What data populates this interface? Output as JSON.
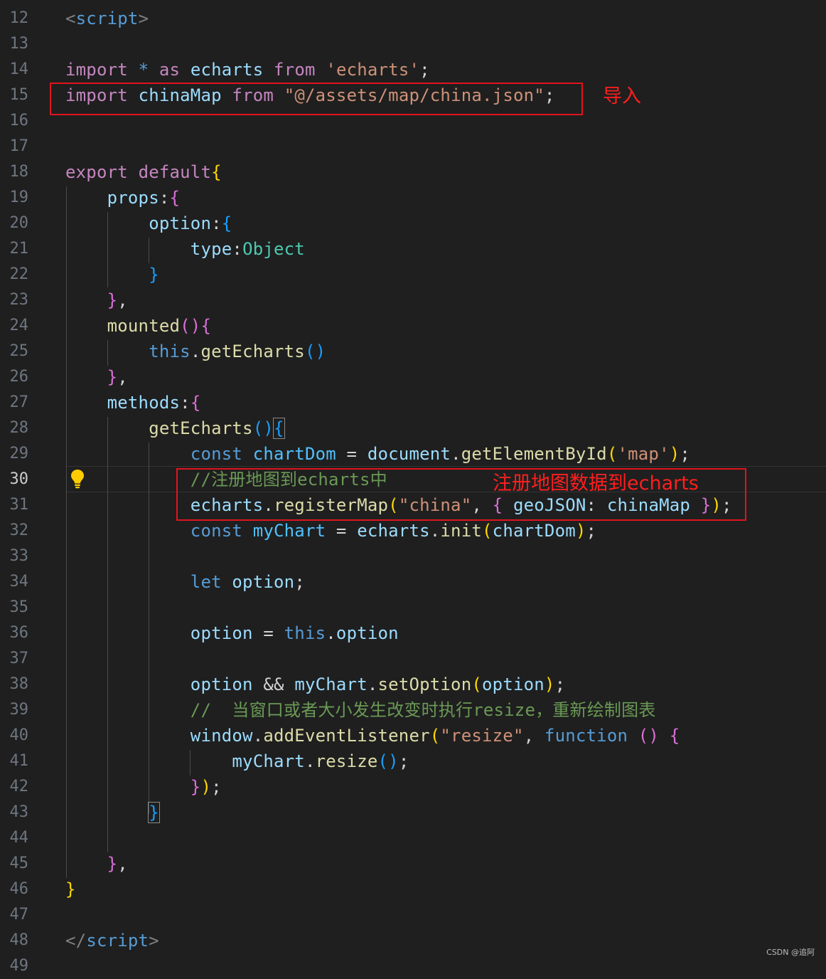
{
  "editor": {
    "active_line": "30",
    "lines": [
      {
        "n": "12",
        "t": [
          [
            "<",
            "#808080"
          ],
          [
            "script",
            "#569cd6"
          ],
          [
            ">",
            "#808080"
          ]
        ]
      },
      {
        "n": "13",
        "t": []
      },
      {
        "n": "14",
        "t": [
          [
            "import",
            "#c586c0"
          ],
          [
            " ",
            "#d4d4d4"
          ],
          [
            "*",
            "#569cd6"
          ],
          [
            " ",
            "#d4d4d4"
          ],
          [
            "as",
            "#c586c0"
          ],
          [
            " ",
            "#d4d4d4"
          ],
          [
            "echarts",
            "#9cdcfe"
          ],
          [
            " ",
            "#d4d4d4"
          ],
          [
            "from",
            "#c586c0"
          ],
          [
            " ",
            "#d4d4d4"
          ],
          [
            "'echarts'",
            "#ce9178"
          ],
          [
            ";",
            "#d4d4d4"
          ]
        ]
      },
      {
        "n": "15",
        "t": [
          [
            "import",
            "#c586c0"
          ],
          [
            " ",
            "#d4d4d4"
          ],
          [
            "chinaMap",
            "#9cdcfe"
          ],
          [
            " ",
            "#d4d4d4"
          ],
          [
            "from",
            "#c586c0"
          ],
          [
            " ",
            "#d4d4d4"
          ],
          [
            "\"@/assets/map/china.json\"",
            "#ce9178"
          ],
          [
            ";",
            "#d4d4d4"
          ]
        ]
      },
      {
        "n": "16",
        "t": []
      },
      {
        "n": "17",
        "t": []
      },
      {
        "n": "18",
        "t": [
          [
            "export",
            "#c586c0"
          ],
          [
            " ",
            "#d4d4d4"
          ],
          [
            "default",
            "#c586c0"
          ],
          [
            "{",
            "#ffd700"
          ]
        ]
      },
      {
        "n": "19",
        "t": [
          [
            "    ",
            "#d4d4d4"
          ],
          [
            "props",
            "#9cdcfe"
          ],
          [
            ":",
            "#d4d4d4"
          ],
          [
            "{",
            "#da70d6"
          ]
        ]
      },
      {
        "n": "20",
        "t": [
          [
            "        ",
            "#d4d4d4"
          ],
          [
            "option",
            "#9cdcfe"
          ],
          [
            ":",
            "#d4d4d4"
          ],
          [
            "{",
            "#179fff"
          ]
        ]
      },
      {
        "n": "21",
        "t": [
          [
            "            ",
            "#d4d4d4"
          ],
          [
            "type",
            "#9cdcfe"
          ],
          [
            ":",
            "#d4d4d4"
          ],
          [
            "Object",
            "#4ec9b0"
          ]
        ]
      },
      {
        "n": "22",
        "t": [
          [
            "        ",
            "#d4d4d4"
          ],
          [
            "}",
            "#179fff"
          ]
        ]
      },
      {
        "n": "23",
        "t": [
          [
            "    ",
            "#d4d4d4"
          ],
          [
            "}",
            "#da70d6"
          ],
          [
            ",",
            "#d4d4d4"
          ]
        ]
      },
      {
        "n": "24",
        "t": [
          [
            "    ",
            "#d4d4d4"
          ],
          [
            "mounted",
            "#dcdcaa"
          ],
          [
            "()",
            "#da70d6"
          ],
          [
            "{",
            "#da70d6"
          ]
        ]
      },
      {
        "n": "25",
        "t": [
          [
            "        ",
            "#d4d4d4"
          ],
          [
            "this",
            "#569cd6"
          ],
          [
            ".",
            "#d4d4d4"
          ],
          [
            "getEcharts",
            "#dcdcaa"
          ],
          [
            "()",
            "#179fff"
          ]
        ]
      },
      {
        "n": "26",
        "t": [
          [
            "    ",
            "#d4d4d4"
          ],
          [
            "}",
            "#da70d6"
          ],
          [
            ",",
            "#d4d4d4"
          ]
        ]
      },
      {
        "n": "27",
        "t": [
          [
            "    ",
            "#d4d4d4"
          ],
          [
            "methods",
            "#9cdcfe"
          ],
          [
            ":",
            "#d4d4d4"
          ],
          [
            "{",
            "#da70d6"
          ]
        ]
      },
      {
        "n": "28",
        "t": [
          [
            "        ",
            "#d4d4d4"
          ],
          [
            "getEcharts",
            "#dcdcaa"
          ],
          [
            "()",
            "#179fff"
          ],
          [
            "{",
            "#179fff",
            "m"
          ]
        ]
      },
      {
        "n": "29",
        "t": [
          [
            "            ",
            "#d4d4d4"
          ],
          [
            "const",
            "#569cd6"
          ],
          [
            " ",
            "#d4d4d4"
          ],
          [
            "chartDom",
            "#4fc1ff"
          ],
          [
            " = ",
            "#d4d4d4"
          ],
          [
            "document",
            "#9cdcfe"
          ],
          [
            ".",
            "#d4d4d4"
          ],
          [
            "getElementById",
            "#dcdcaa"
          ],
          [
            "(",
            "#ffd700"
          ],
          [
            "'map'",
            "#ce9178"
          ],
          [
            ")",
            "#ffd700"
          ],
          [
            ";",
            "#d4d4d4"
          ]
        ]
      },
      {
        "n": "30",
        "t": [
          [
            "            ",
            "#d4d4d4"
          ],
          [
            "//注册地图到echarts中",
            "#6a9955"
          ]
        ]
      },
      {
        "n": "31",
        "t": [
          [
            "            ",
            "#d4d4d4"
          ],
          [
            "echarts",
            "#9cdcfe"
          ],
          [
            ".",
            "#d4d4d4"
          ],
          [
            "registerMap",
            "#dcdcaa"
          ],
          [
            "(",
            "#ffd700"
          ],
          [
            "\"china\"",
            "#ce9178"
          ],
          [
            ", ",
            "#d4d4d4"
          ],
          [
            "{",
            "#da70d6"
          ],
          [
            " ",
            "#d4d4d4"
          ],
          [
            "geoJSON",
            "#9cdcfe"
          ],
          [
            ": ",
            "#d4d4d4"
          ],
          [
            "chinaMap",
            "#9cdcfe"
          ],
          [
            " ",
            "#d4d4d4"
          ],
          [
            "}",
            "#da70d6"
          ],
          [
            ")",
            "#ffd700"
          ],
          [
            ";",
            "#d4d4d4"
          ]
        ]
      },
      {
        "n": "32",
        "t": [
          [
            "            ",
            "#d4d4d4"
          ],
          [
            "const",
            "#569cd6"
          ],
          [
            " ",
            "#d4d4d4"
          ],
          [
            "myChart",
            "#4fc1ff"
          ],
          [
            " = ",
            "#d4d4d4"
          ],
          [
            "echarts",
            "#9cdcfe"
          ],
          [
            ".",
            "#d4d4d4"
          ],
          [
            "init",
            "#dcdcaa"
          ],
          [
            "(",
            "#ffd700"
          ],
          [
            "chartDom",
            "#9cdcfe"
          ],
          [
            ")",
            "#ffd700"
          ],
          [
            ";",
            "#d4d4d4"
          ]
        ]
      },
      {
        "n": "33",
        "t": []
      },
      {
        "n": "34",
        "t": [
          [
            "            ",
            "#d4d4d4"
          ],
          [
            "let",
            "#569cd6"
          ],
          [
            " ",
            "#d4d4d4"
          ],
          [
            "option",
            "#9cdcfe"
          ],
          [
            ";",
            "#d4d4d4"
          ]
        ]
      },
      {
        "n": "35",
        "t": []
      },
      {
        "n": "36",
        "t": [
          [
            "            ",
            "#d4d4d4"
          ],
          [
            "option",
            "#9cdcfe"
          ],
          [
            " = ",
            "#d4d4d4"
          ],
          [
            "this",
            "#569cd6"
          ],
          [
            ".",
            "#d4d4d4"
          ],
          [
            "option",
            "#9cdcfe"
          ]
        ]
      },
      {
        "n": "37",
        "t": []
      },
      {
        "n": "38",
        "t": [
          [
            "            ",
            "#d4d4d4"
          ],
          [
            "option",
            "#9cdcfe"
          ],
          [
            " && ",
            "#d4d4d4"
          ],
          [
            "myChart",
            "#9cdcfe"
          ],
          [
            ".",
            "#d4d4d4"
          ],
          [
            "setOption",
            "#dcdcaa"
          ],
          [
            "(",
            "#ffd700"
          ],
          [
            "option",
            "#9cdcfe"
          ],
          [
            ")",
            "#ffd700"
          ],
          [
            ";",
            "#d4d4d4"
          ]
        ]
      },
      {
        "n": "39",
        "t": [
          [
            "            ",
            "#d4d4d4"
          ],
          [
            "//  当窗口或者大小发生改变时执行resize，重新绘制图表",
            "#6a9955"
          ]
        ]
      },
      {
        "n": "40",
        "t": [
          [
            "            ",
            "#d4d4d4"
          ],
          [
            "window",
            "#9cdcfe"
          ],
          [
            ".",
            "#d4d4d4"
          ],
          [
            "addEventListener",
            "#dcdcaa"
          ],
          [
            "(",
            "#ffd700"
          ],
          [
            "\"resize\"",
            "#ce9178"
          ],
          [
            ", ",
            "#d4d4d4"
          ],
          [
            "function",
            "#569cd6"
          ],
          [
            " ",
            "#d4d4d4"
          ],
          [
            "()",
            "#da70d6"
          ],
          [
            " ",
            "#d4d4d4"
          ],
          [
            "{",
            "#da70d6"
          ]
        ]
      },
      {
        "n": "41",
        "t": [
          [
            "                ",
            "#d4d4d4"
          ],
          [
            "myChart",
            "#9cdcfe"
          ],
          [
            ".",
            "#d4d4d4"
          ],
          [
            "resize",
            "#dcdcaa"
          ],
          [
            "()",
            "#179fff"
          ],
          [
            ";",
            "#d4d4d4"
          ]
        ]
      },
      {
        "n": "42",
        "t": [
          [
            "            ",
            "#d4d4d4"
          ],
          [
            "}",
            "#da70d6"
          ],
          [
            ")",
            "#ffd700"
          ],
          [
            ";",
            "#d4d4d4"
          ]
        ]
      },
      {
        "n": "43",
        "t": [
          [
            "        ",
            "#d4d4d4"
          ],
          [
            "}",
            "#179fff",
            "m"
          ]
        ]
      },
      {
        "n": "44",
        "t": []
      },
      {
        "n": "45",
        "t": [
          [
            "    ",
            "#d4d4d4"
          ],
          [
            "}",
            "#da70d6"
          ],
          [
            ",",
            "#d4d4d4"
          ]
        ]
      },
      {
        "n": "46",
        "t": [
          [
            "}",
            "#ffd700"
          ]
        ]
      },
      {
        "n": "47",
        "t": []
      },
      {
        "n": "48",
        "t": [
          [
            "</",
            "#808080"
          ],
          [
            "script",
            "#569cd6"
          ],
          [
            ">",
            "#808080"
          ]
        ]
      },
      {
        "n": "49",
        "t": []
      }
    ]
  },
  "annotations": {
    "import_label": "导入",
    "register_label": "注册地图数据到echarts",
    "color": "#e0141e"
  },
  "watermark": "CSDN @追阿",
  "icons": {
    "lightbulb": "lightbulb-icon"
  }
}
